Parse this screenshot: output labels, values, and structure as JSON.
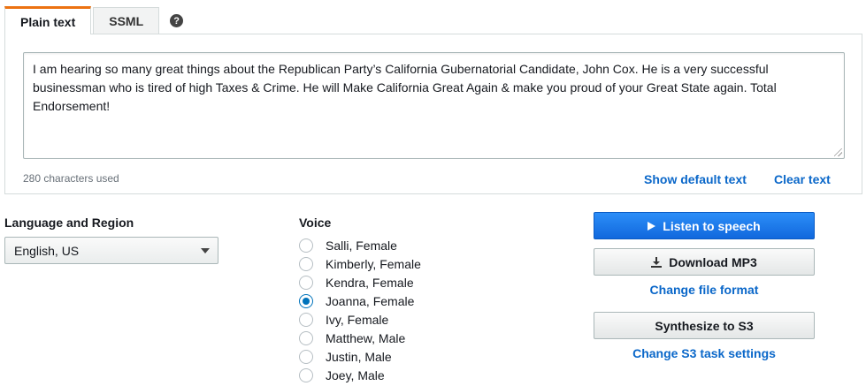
{
  "tabs": [
    {
      "label": "Plain text",
      "active": true
    },
    {
      "label": "SSML",
      "active": false
    }
  ],
  "help_glyph": "?",
  "editor": {
    "text": "I am hearing so many great things about the Republican Party’s California Gubernatorial Candidate, John Cox. He is a very successful businessman who is tired of high Taxes & Crime. He will Make California Great Again &  make you proud of your Great State again. Total Endorsement!",
    "char_count": "280 characters used",
    "show_default_label": "Show default text",
    "clear_label": "Clear text"
  },
  "language": {
    "label": "Language and Region",
    "selected": "English, US"
  },
  "voice": {
    "label": "Voice",
    "options": [
      {
        "name": "Salli, Female",
        "selected": false
      },
      {
        "name": "Kimberly, Female",
        "selected": false
      },
      {
        "name": "Kendra, Female",
        "selected": false
      },
      {
        "name": "Joanna, Female",
        "selected": true
      },
      {
        "name": "Ivy, Female",
        "selected": false
      },
      {
        "name": "Matthew, Male",
        "selected": false
      },
      {
        "name": "Justin, Male",
        "selected": false
      },
      {
        "name": "Joey, Male",
        "selected": false
      }
    ]
  },
  "actions": {
    "listen_label": "Listen to speech",
    "download_label": "Download MP3",
    "change_format_label": "Change file format",
    "synthesize_label": "Synthesize to S3",
    "change_s3_label": "Change S3 task settings"
  },
  "colors": {
    "accent_tab": "#ec7211",
    "primary_button": "#1a73e8",
    "link": "#0a67c9"
  }
}
